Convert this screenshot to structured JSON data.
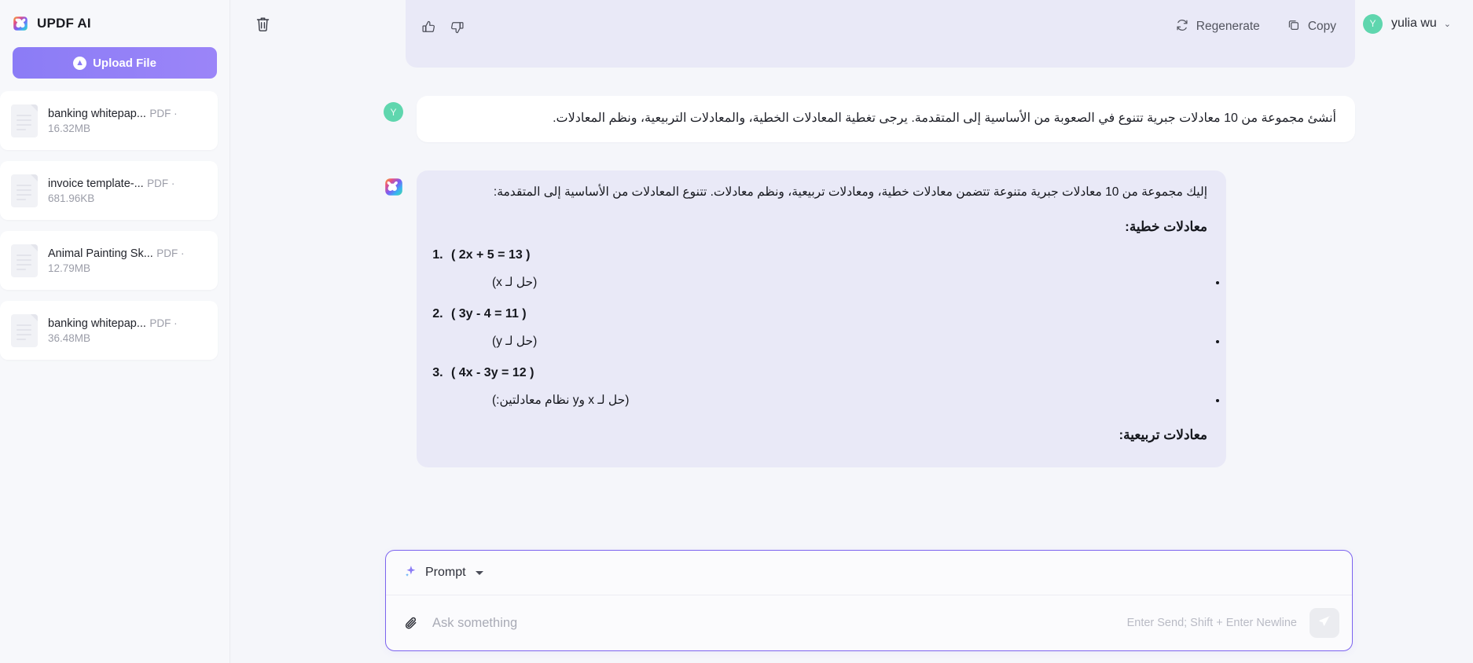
{
  "sidebar": {
    "brand_title": "UPDF AI",
    "brand_logo_icon": "updf-clover-logo-icon",
    "upload_label": "Upload File",
    "upload_icon": "upload-arrow-icon",
    "files": [
      {
        "name": "banking whitepap...",
        "meta": "PDF · 16.32MB",
        "icon": "pdf-file-icon"
      },
      {
        "name": "invoice template-...",
        "meta": "PDF · 681.96KB",
        "icon": "pdf-file-icon"
      },
      {
        "name": "Animal Painting Sk...",
        "meta": "PDF · 12.79MB",
        "icon": "pdf-file-icon"
      },
      {
        "name": "banking whitepap...",
        "meta": "PDF · 36.48MB",
        "icon": "pdf-file-icon"
      }
    ]
  },
  "topbar": {
    "trash_icon": "trash-icon",
    "user_initial": "Y",
    "user_name": "yulia wu",
    "caret_icon": "chevron-down-icon"
  },
  "message_actions": {
    "like_icon": "thumbs-up-icon",
    "dislike_icon": "thumbs-down-icon",
    "regenerate_label": "Regenerate",
    "regenerate_icon": "regenerate-icon",
    "copy_label": "Copy",
    "copy_icon": "copy-icon"
  },
  "conversation": {
    "user_avatar_initial": "Y",
    "user_message": "أنشئ مجموعة من 10 معادلات جبرية تتنوع في الصعوبة من الأساسية إلى المتقدمة. يرجى تغطية المعادلات الخطية، والمعادلات التربيعية، ونظم المعادلات.",
    "ai_avatar_icon": "updf-ai-clover-icon",
    "ai_intro": "إليك مجموعة من 10 معادلات جبرية متنوعة تتضمن معادلات خطية، ومعادلات تربيعية، ونظم معادلات. تتنوع المعادلات من الأساسية إلى المتقدمة:",
    "sections": [
      {
        "heading": "معادلات خطية:",
        "items": [
          {
            "equation": "( 2x + 5 = 13 )",
            "note": "(حل لـ x)"
          },
          {
            "equation": "( 3y - 4 = 11 )",
            "note": "(حل لـ y)"
          },
          {
            "equation": "( 4x - 3y = 12 )",
            "note": "(حل لـ x وy نظام معادلتين:)"
          }
        ]
      },
      {
        "heading": "معادلات تربيعية:",
        "items": []
      }
    ]
  },
  "prompt": {
    "mode_label": "Prompt",
    "mode_icon": "sparkle-icon",
    "dropdown_icon": "triangle-down-icon",
    "attach_icon": "paperclip-icon",
    "input_value": "",
    "input_placeholder": "Ask something",
    "hint": "Enter Send; Shift + Enter Newline",
    "send_icon": "send-paper-plane-icon"
  },
  "colors": {
    "accent": "#8b7cf6",
    "prompt_border": "#7c63ef",
    "ai_bubble": "#e9e9f7",
    "avatar_green": "#5fd6ae",
    "page_bg": "#f5f6fa"
  }
}
